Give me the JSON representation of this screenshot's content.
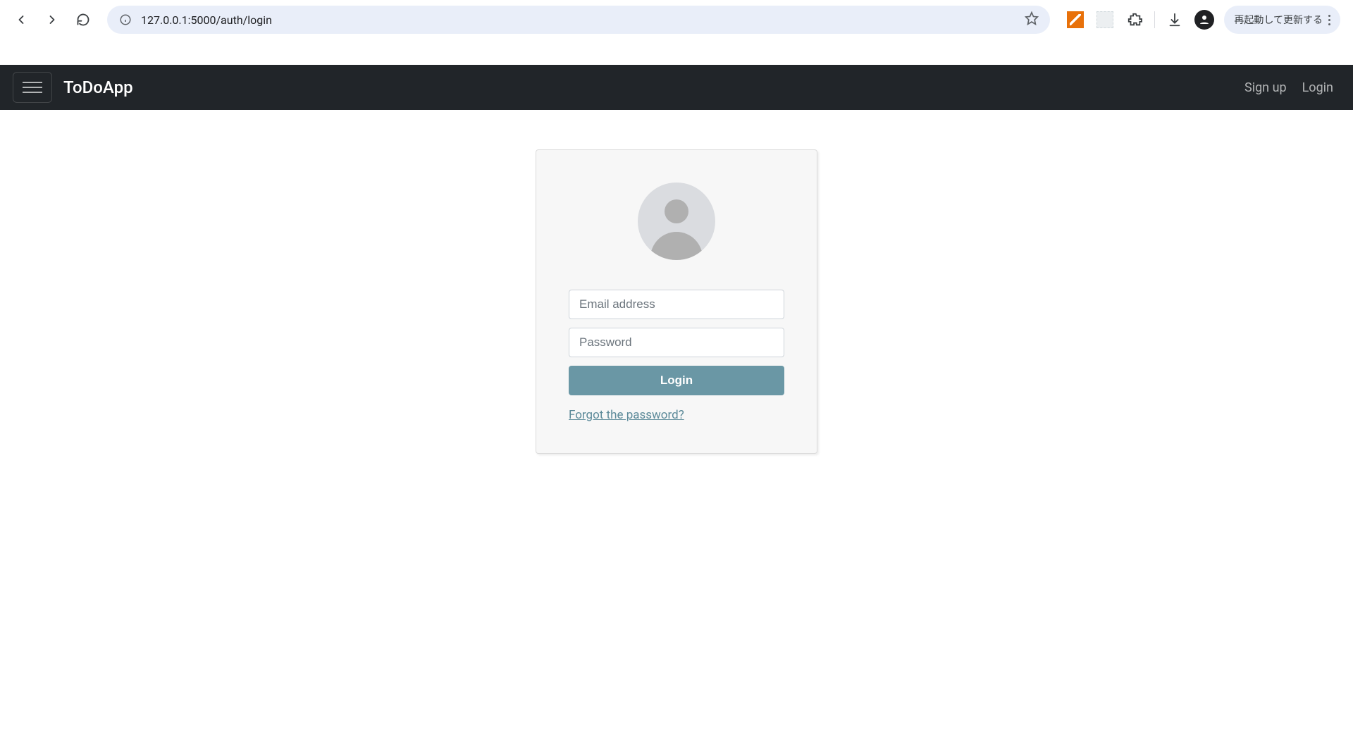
{
  "browser": {
    "url": "127.0.0.1:5000/auth/login",
    "relaunch_label": "再起動して更新する"
  },
  "navbar": {
    "brand": "ToDoApp",
    "links": {
      "signup": "Sign up",
      "login": "Login"
    }
  },
  "login": {
    "email_placeholder": "Email address",
    "password_placeholder": "Password",
    "login_button": "Login",
    "forgot_link": "Forgot the password?"
  }
}
